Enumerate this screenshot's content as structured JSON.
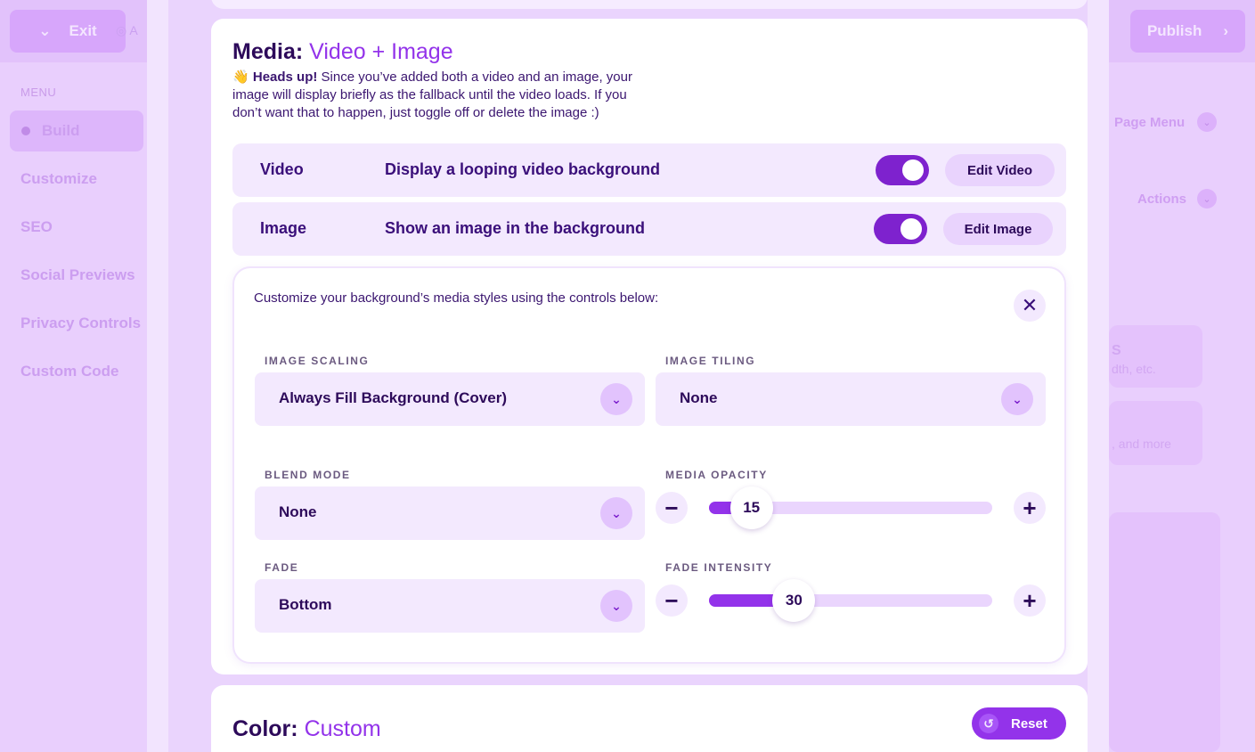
{
  "background_app": {
    "exit_label": "Exit",
    "autosave_text": "A",
    "publish_label": "Publish",
    "menu_label": "MENU",
    "nav_items": [
      "Build",
      "Customize",
      "SEO",
      "Social Previews",
      "Privacy Controls",
      "Custom Code"
    ],
    "right_panel": {
      "page_menu_label": "Page Menu",
      "actions_label": "Actions",
      "snippet_1": "S",
      "snippet_2": "dth, etc.",
      "snippet_3": ", and more"
    }
  },
  "media_card": {
    "title_prefix": "Media:",
    "title_accent": "Video + Image",
    "heads_up_emoji": "👋",
    "heads_up_bold": "Heads up!",
    "heads_up_text": "Since you’ve added both a video and an image, your image will display briefly as the fallback until the video loads. If you don’t want that to happen, just toggle off or delete the image :)",
    "rows": [
      {
        "name": "Video",
        "description": "Display a looping video background",
        "toggle_on": true,
        "edit_label": "Edit Video"
      },
      {
        "name": "Image",
        "description": "Show an image in the background",
        "toggle_on": true,
        "edit_label": "Edit Image"
      }
    ],
    "customize": {
      "intro": "Customize your background’s media styles using the controls below:",
      "close_icon": "✕",
      "image_scaling": {
        "label": "IMAGE SCALING",
        "value": "Always Fill Background (Cover)"
      },
      "image_tiling": {
        "label": "IMAGE TILING",
        "value": "None"
      },
      "blend_mode": {
        "label": "BLEND MODE",
        "value": "None"
      },
      "media_opacity": {
        "label": "MEDIA OPACITY",
        "value": "15",
        "fraction": 0.15
      },
      "fade": {
        "label": "FADE",
        "value": "Bottom"
      },
      "fade_intensity": {
        "label": "FADE INTENSITY",
        "value": "30",
        "fraction": 0.3
      },
      "minus_symbol": "−",
      "plus_symbol": "+"
    }
  },
  "color_card": {
    "title_prefix": "Color:",
    "title_accent": "Custom",
    "reset_label": "Reset",
    "reset_icon": "↺"
  },
  "colors": {
    "accent": "#9333ea",
    "toggle": "#7e22ce",
    "dark_text": "#2d0a5a",
    "surface_tint": "#f3e9fe"
  }
}
